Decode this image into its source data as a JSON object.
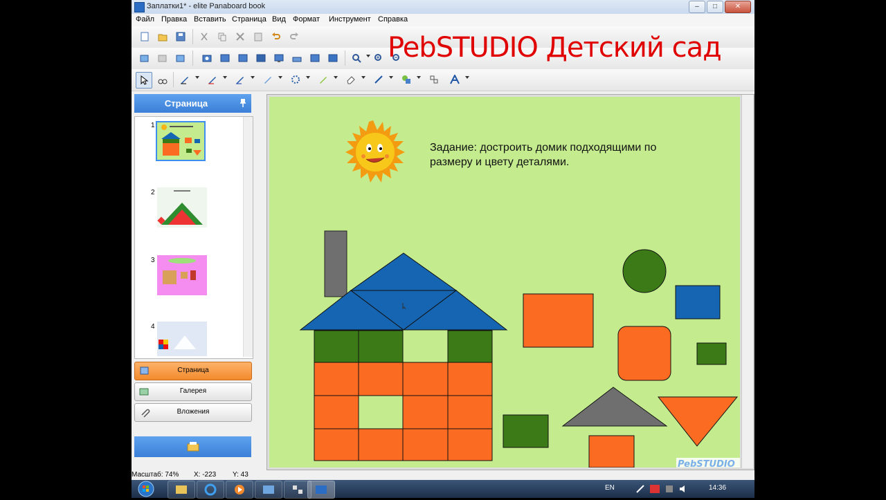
{
  "window": {
    "title": "Заплатки1* - elite Panaboard book",
    "minimize": "–",
    "maximize": "□",
    "close": "✕"
  },
  "menu": [
    "Файл",
    "Правка",
    "Вставить",
    "Страница",
    "Вид",
    "Формат",
    "Инструмент",
    "Справка"
  ],
  "overlay_title": "PebSTUDIO Детский сад",
  "page_panel": {
    "title": "Страница",
    "pages": [
      "1",
      "2",
      "3",
      "4"
    ],
    "tabs": [
      {
        "label": "Страница",
        "active": true
      },
      {
        "label": "Галерея",
        "active": false
      },
      {
        "label": "Вложения",
        "active": false
      }
    ]
  },
  "slide": {
    "task_text_line1": "Задание: достроить домик подходящими по",
    "task_text_line2": "размеру и цвету деталями.",
    "logo": "PebSTUDIO",
    "colors": {
      "background": "#c4ec8f",
      "orange": "#fb6b22",
      "green": "#3b7a16",
      "blue": "#1565b3",
      "gray": "#6f6f6f",
      "sun": "#f7b318"
    }
  },
  "status_bar": {
    "zoom": "Масштаб: 74%",
    "x": "X: -223",
    "y": "Y: 43"
  },
  "taskbar": {
    "language": "EN",
    "clock": "14:36"
  }
}
